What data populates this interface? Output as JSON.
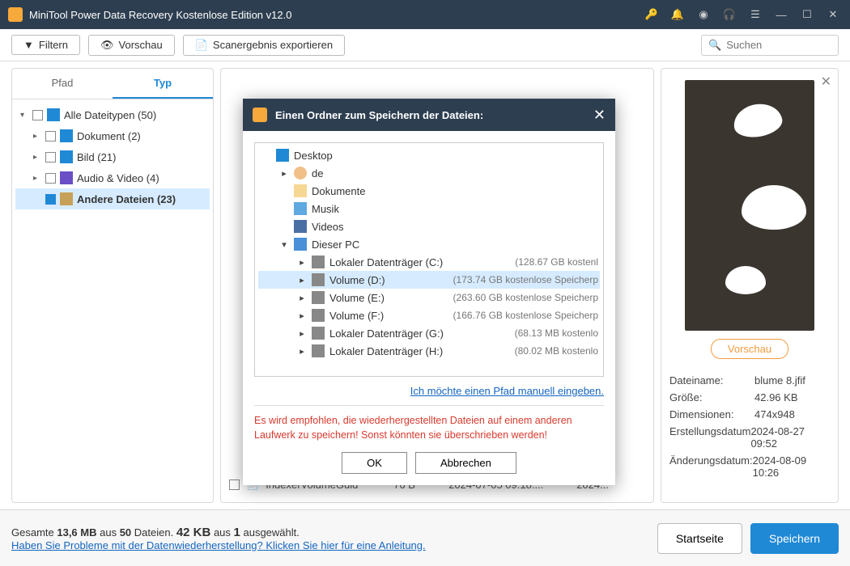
{
  "app": {
    "title": "MiniTool Power Data Recovery Kostenlose Edition v12.0"
  },
  "toolbar": {
    "filter": "Filtern",
    "preview": "Vorschau",
    "export": "Scanergebnis exportieren",
    "search_ph": "Suchen"
  },
  "tabs": {
    "path": "Pfad",
    "type": "Typ"
  },
  "tree": {
    "all": "Alle Dateitypen (50)",
    "doc": "Dokument (2)",
    "img": "Bild (21)",
    "av": "Audio & Video (4)",
    "oth": "Andere Dateien (23)"
  },
  "filerow": {
    "name": "IndexerVolumeGuid",
    "size": "76 B",
    "date": "2024-07-05 09:18:...",
    "d2": "2024..."
  },
  "preview": {
    "btn": "Vorschau"
  },
  "meta": {
    "fn_l": "Dateiname:",
    "fn_v": "blume 8.jfif",
    "sz_l": "Größe:",
    "sz_v": "42.96 KB",
    "dm_l": "Dimensionen:",
    "dm_v": "474x948",
    "cr_l": "Erstellungsdatum",
    "cr_v": "2024-08-27 09:52",
    "md_l": "Änderungsdatum:",
    "md_v": "2024-08-09 10:26"
  },
  "footer": {
    "l1a": "Gesamte ",
    "l1b": "13,6 MB",
    "l1c": " aus ",
    "l1d": "50",
    "l1e": " Dateien.  ",
    "l1f": "42 KB",
    "l1g": " aus ",
    "l1h": "1",
    "l1i": " ausgewählt.",
    "l2": "Haben Sie Probleme mit der Datenwiederherstellung? Klicken Sie hier für eine Anleitung.",
    "home": "Startseite",
    "save": "Speichern"
  },
  "modal": {
    "title": "Einen Ordner zum Speichern der Dateien:",
    "link": "Ich möchte einen Pfad manuell eingeben.",
    "warn": "Es wird empfohlen, die wiederhergestellten Dateien auf einem anderen Laufwerk zu speichern! Sonst könnten sie überschrieben werden!",
    "ok": "OK",
    "cancel": "Abbrechen",
    "items": [
      {
        "ind": 0,
        "car": "",
        "ic": "desk",
        "name": "Desktop",
        "size": ""
      },
      {
        "ind": 1,
        "car": "▸",
        "ic": "user",
        "name": "de",
        "size": ""
      },
      {
        "ind": 1,
        "car": "",
        "ic": "fold",
        "name": "Dokumente",
        "size": ""
      },
      {
        "ind": 1,
        "car": "",
        "ic": "mus",
        "name": "Musik",
        "size": ""
      },
      {
        "ind": 1,
        "car": "",
        "ic": "vid",
        "name": "Videos",
        "size": ""
      },
      {
        "ind": 1,
        "car": "▾",
        "ic": "pc",
        "name": "Dieser PC",
        "size": ""
      },
      {
        "ind": 2,
        "car": "▸",
        "ic": "drv",
        "name": "Lokaler Datenträger (C:)",
        "size": "(128.67 GB kostenl"
      },
      {
        "ind": 2,
        "car": "▸",
        "ic": "drv",
        "name": "Volume (D:)",
        "size": "(173.74 GB kostenlose Speicherp",
        "sel": true
      },
      {
        "ind": 2,
        "car": "▸",
        "ic": "drv",
        "name": "Volume (E:)",
        "size": "(263.60 GB kostenlose Speicherp"
      },
      {
        "ind": 2,
        "car": "▸",
        "ic": "drv",
        "name": "Volume (F:)",
        "size": "(166.76 GB kostenlose Speicherp"
      },
      {
        "ind": 2,
        "car": "▸",
        "ic": "drv",
        "name": "Lokaler Datenträger (G:)",
        "size": "(68.13 MB kostenlo"
      },
      {
        "ind": 2,
        "car": "▸",
        "ic": "drv",
        "name": "Lokaler Datenträger (H:)",
        "size": "(80.02 MB kostenlo"
      }
    ]
  }
}
